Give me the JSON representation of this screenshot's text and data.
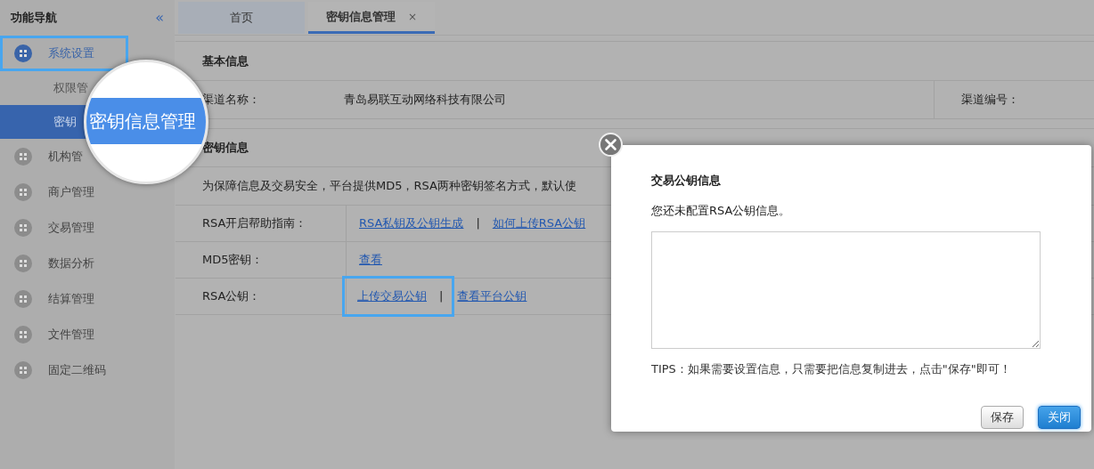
{
  "sidebar": {
    "title": "功能导航",
    "collapse": "«",
    "items": [
      {
        "label": "系统设置",
        "selected": true,
        "highlighted": true,
        "children": [
          {
            "label": "权限管",
            "selected": false
          },
          {
            "label": "密钥",
            "selected": true
          }
        ]
      },
      {
        "label": "机构管",
        "selected": false,
        "highlighted": false
      },
      {
        "label": "商户管理",
        "selected": false,
        "highlighted": false
      },
      {
        "label": "交易管理",
        "selected": false,
        "highlighted": false
      },
      {
        "label": "数据分析",
        "selected": false,
        "highlighted": false
      },
      {
        "label": "结算管理",
        "selected": false,
        "highlighted": false
      },
      {
        "label": "文件管理",
        "selected": false,
        "highlighted": false
      },
      {
        "label": "固定二维码",
        "selected": false,
        "highlighted": false
      }
    ]
  },
  "magnifier": {
    "text": "密钥信息管理"
  },
  "tabs": [
    {
      "label": "首页",
      "selected": false
    },
    {
      "label": "密钥信息管理",
      "selected": true,
      "close": "×"
    }
  ],
  "basic_info": {
    "heading": "基本信息",
    "fields": [
      {
        "label": "渠道名称：",
        "value": "青岛易联互动网络科技有限公司"
      },
      {
        "label": "渠道编号："
      }
    ]
  },
  "key_info": {
    "heading": "密钥信息",
    "note": "为保障信息及交易安全，平台提供MD5，RSA两种密钥签名方式，默认使",
    "rows": [
      {
        "label": "RSA开启帮助指南：",
        "links": [
          {
            "kind": "link",
            "text": "RSA私钥及公钥生成",
            "highlighted": false
          },
          {
            "kind": "separator",
            "text": "|",
            "highlighted": false
          },
          {
            "kind": "link",
            "text": "如何上传RSA公钥",
            "highlighted": false
          }
        ]
      },
      {
        "label": "MD5密钥：",
        "links": [
          {
            "kind": "link",
            "text": "查看",
            "highlighted": false
          }
        ]
      },
      {
        "label": "RSA公钥：",
        "links": [
          {
            "kind": "link",
            "text": "上传交易公钥",
            "highlighted": true
          },
          {
            "kind": "separator",
            "text": "|",
            "highlighted": true
          },
          {
            "kind": "link",
            "text": "查看平台公钥",
            "highlighted": false
          }
        ]
      }
    ]
  },
  "modal": {
    "title": "交易公钥信息",
    "message": "您还未配置RSA公钥信息。",
    "tips": "TIPS：如果需要设置信息，只需要把信息复制进去，点击\"保存\"即可！",
    "buttons": [
      {
        "label": "保存",
        "primary": false
      },
      {
        "label": "关闭",
        "primary": true
      }
    ]
  }
}
